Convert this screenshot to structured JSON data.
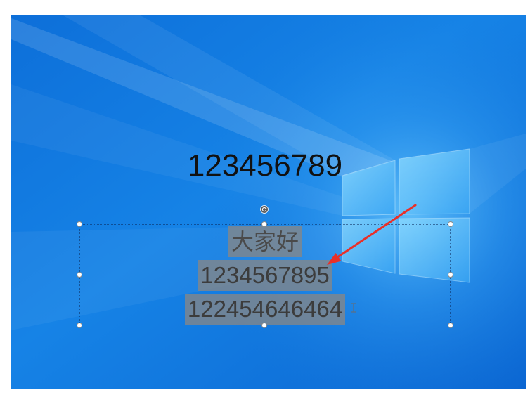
{
  "slide": {
    "title": "123456789"
  },
  "textbox": {
    "lines": [
      "大家好",
      "1234567895",
      "122454646464"
    ]
  },
  "icons": {
    "rotate_handle": "rotate-icon",
    "text_cursor": "text-cursor-icon",
    "annotation": "red-arrow-annotation",
    "logo": "windows-logo"
  },
  "colors": {
    "selection_highlight": "rgba(135,135,135,0.78)",
    "title_text": "#111111",
    "body_text": "#3c3c3c",
    "annotation_arrow": "#e8302a",
    "wallpaper_blue": "#1279de"
  }
}
